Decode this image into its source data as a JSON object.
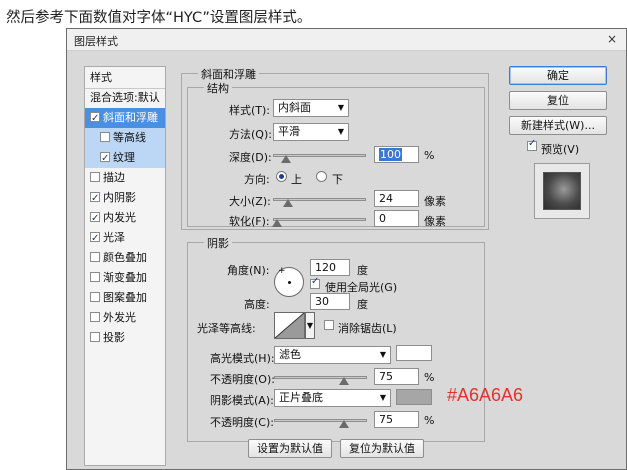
{
  "caption": "然后参考下面数值对字体“HYC”设置图层样式。",
  "dialog": {
    "title": "图层样式",
    "close": "×"
  },
  "styles_list": {
    "header": "样式",
    "blend": "混合选项:默认",
    "items": [
      {
        "label": "斜面和浮雕",
        "checked": true
      },
      {
        "label": "等高线",
        "checked": false
      },
      {
        "label": "纹理",
        "checked": true
      },
      {
        "label": "描边",
        "checked": false
      },
      {
        "label": "内阴影",
        "checked": true
      },
      {
        "label": "内发光",
        "checked": true
      },
      {
        "label": "光泽",
        "checked": true
      },
      {
        "label": "颜色叠加",
        "checked": false
      },
      {
        "label": "渐变叠加",
        "checked": false
      },
      {
        "label": "图案叠加",
        "checked": false
      },
      {
        "label": "外发光",
        "checked": false
      },
      {
        "label": "投影",
        "checked": false
      }
    ]
  },
  "bevel": {
    "group_label": "斜面和浮雕",
    "structure_label": "结构",
    "style_label": "样式(T):",
    "style_value": "内斜面",
    "technique_label": "方法(Q):",
    "technique_value": "平滑",
    "depth_label": "深度(D):",
    "depth_value": "100",
    "depth_unit": "%",
    "depth_level": 0.1,
    "direction_label": "方向:",
    "dir_up": "上",
    "dir_down": "下",
    "size_label": "大小(Z):",
    "size_value": "24",
    "size_unit": "像素",
    "size_level": 0.12,
    "soften_label": "软化(F):",
    "soften_value": "0",
    "soften_unit": "像素",
    "soften_level": 0.0
  },
  "shading": {
    "group_label": "阴影",
    "angle_label": "角度(N):",
    "angle_value": "120",
    "angle_unit": "度",
    "global_light_label": "使用全局光(G)",
    "global_light_checked": true,
    "altitude_label": "高度:",
    "altitude_value": "30",
    "altitude_unit": "度",
    "gloss_label": "光泽等高线:",
    "antialias_label": "消除锯齿(L)",
    "antialias_checked": false,
    "highlight_mode_label": "高光模式(H):",
    "highlight_mode_value": "滤色",
    "highlight_color": "#FFFFFF",
    "highlight_opacity_label": "不透明度(O):",
    "highlight_opacity_value": "75",
    "highlight_opacity_unit": "%",
    "highlight_opacity_level": 0.75,
    "shadow_mode_label": "阴影模式(A):",
    "shadow_mode_value": "正片叠底",
    "shadow_color": "#A6A6A6",
    "shadow_opacity_label": "不透明度(C):",
    "shadow_opacity_value": "75",
    "shadow_opacity_unit": "%",
    "shadow_opacity_level": 0.75
  },
  "annotation": "#A6A6A6",
  "buttons": {
    "ok": "确定",
    "reset": "复位",
    "new_style": "新建样式(W)...",
    "preview": "预览(V)",
    "preview_checked": true,
    "make_default": "设置为默认值",
    "reset_default": "复位为默认值"
  },
  "colors": {
    "selected": "#4A90E2",
    "sub_selected": "#BCD7F5",
    "annotation": "#E0342A"
  }
}
